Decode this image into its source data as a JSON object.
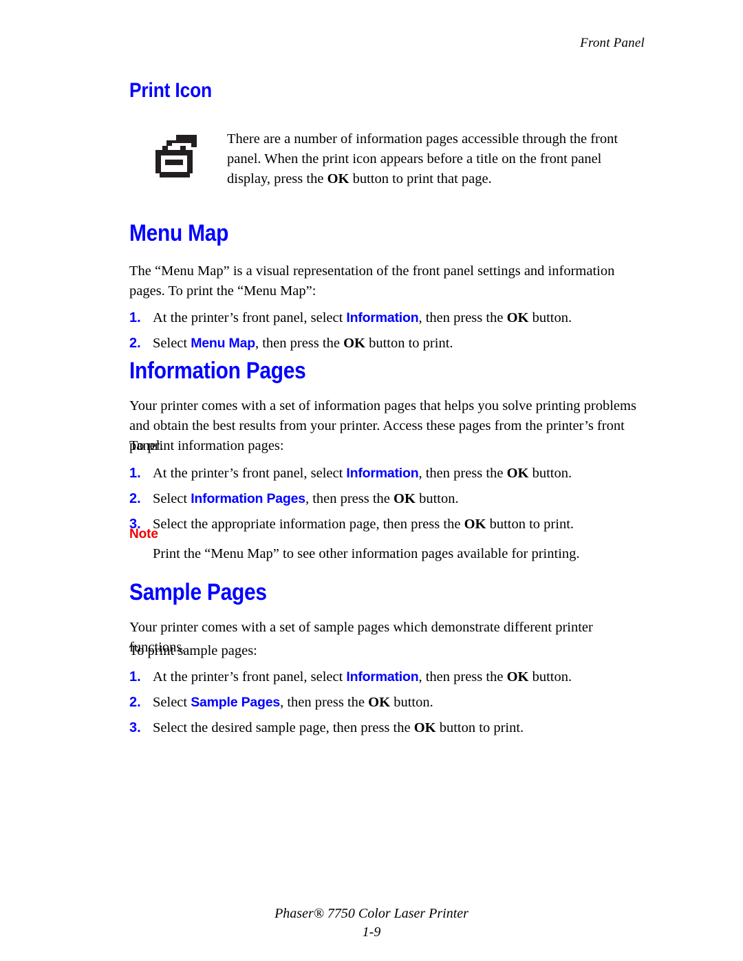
{
  "header": {
    "running_head": "Front Panel"
  },
  "sections": {
    "print_icon": {
      "heading": "Print Icon",
      "icon_name": "printer-icon",
      "body_1": "There are a number of information pages accessible through the front panel. When the print icon appears before a title on the front panel display, press the ",
      "body_ok": "OK",
      "body_2": " button to print that page."
    },
    "menu_map": {
      "heading": "Menu Map",
      "intro": "The “Menu Map” is a visual representation of the front panel settings and information pages. To print the “Menu Map”:",
      "steps": [
        {
          "number": "1.",
          "pre": "At the printer’s front panel, select ",
          "term": "Information",
          "mid": ", then press the ",
          "ok": "OK",
          "post": " button."
        },
        {
          "number": "2.",
          "pre": "Select ",
          "term": "Menu Map",
          "mid": ", then press the ",
          "ok": "OK",
          "post": " button to print."
        }
      ]
    },
    "information_pages": {
      "heading": "Information Pages",
      "intro": "Your printer comes with a set of information pages that helps you solve printing problems and obtain the best results from your printer. Access these pages from the printer’s front panel.",
      "lead_in": "To print information pages:",
      "steps": [
        {
          "number": "1.",
          "pre": "At the printer’s front panel, select ",
          "term": "Information",
          "mid": ", then press the ",
          "ok": "OK",
          "post": " button."
        },
        {
          "number": "2.",
          "pre": "Select ",
          "term": "Information Pages",
          "mid": ", then press the ",
          "ok": "OK",
          "post": " button."
        },
        {
          "number": "3.",
          "pre": "Select the appropriate information page, then press the ",
          "term": "",
          "mid": "",
          "ok": "OK",
          "post": " button to print."
        }
      ],
      "note_label": "Note",
      "note_text": "Print the “Menu Map” to see other information pages available for printing."
    },
    "sample_pages": {
      "heading": "Sample Pages",
      "intro": "Your printer comes with a set of sample pages which demonstrate different printer functions.",
      "lead_in": "To print sample pages:",
      "steps": [
        {
          "number": "1.",
          "pre": "At the printer’s front panel, select ",
          "term": "Information",
          "mid": ", then press the ",
          "ok": "OK",
          "post": " button."
        },
        {
          "number": "2.",
          "pre": "Select ",
          "term": "Sample Pages",
          "mid": ", then press the ",
          "ok": "OK",
          "post": " button."
        },
        {
          "number": "3.",
          "pre": "Select the desired sample page, then press the ",
          "term": "",
          "mid": "",
          "ok": "OK",
          "post": " button to print."
        }
      ]
    }
  },
  "footer": {
    "product_line": "Phaser® 7750 Color Laser Printer",
    "page_number": "1-9"
  },
  "colors": {
    "heading_blue": "#0000ff",
    "note_red": "#ee0000",
    "body_black": "#000000",
    "icon_dark": "#231f20"
  }
}
